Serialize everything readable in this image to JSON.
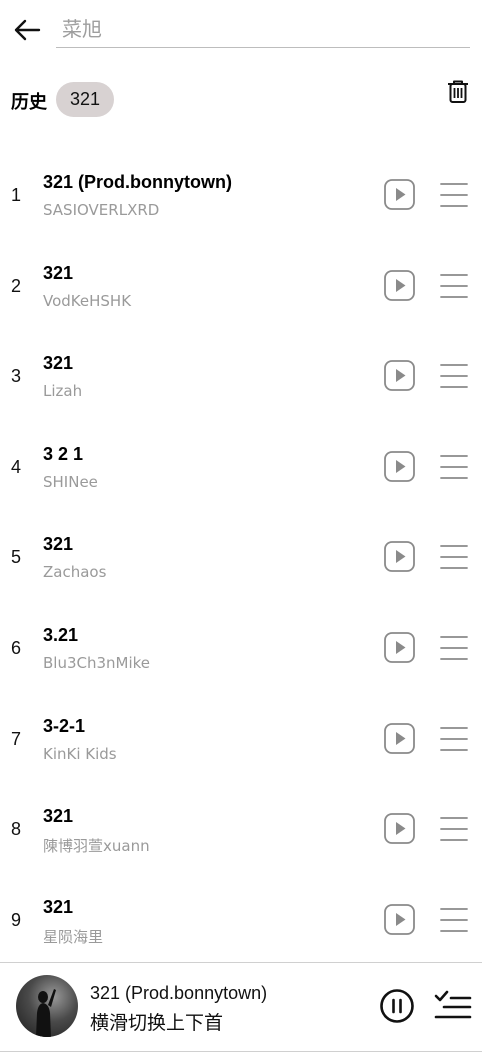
{
  "search": {
    "placeholder": "菜旭"
  },
  "history": {
    "label": "历史",
    "chips": [
      "321"
    ]
  },
  "songs": [
    {
      "index": "1",
      "title": "321 (Prod.bonnytown)",
      "artist": "SASIOVERLXRD"
    },
    {
      "index": "2",
      "title": "321",
      "artist": "VodKeHSHK"
    },
    {
      "index": "3",
      "title": "321",
      "artist": "Lizah"
    },
    {
      "index": "4",
      "title": "3 2 1",
      "artist": "SHINee"
    },
    {
      "index": "5",
      "title": "321",
      "artist": "Zachaos"
    },
    {
      "index": "6",
      "title": "3.21",
      "artist": "Blu3Ch3nMike"
    },
    {
      "index": "7",
      "title": "3-2-1",
      "artist": "KinKi Kids"
    },
    {
      "index": "8",
      "title": "321",
      "artist": "陳博羽萱xuann"
    },
    {
      "index": "9",
      "title": "321",
      "artist": "星陨海里"
    }
  ],
  "player": {
    "title": "321 (Prod.bonnytown)",
    "subtitle": "横滑切换上下首"
  },
  "icons": {
    "back": "arrow-left-icon",
    "trash": "trash-icon",
    "play": "play-circle-icon",
    "menu": "menu-icon",
    "pause": "pause-circle-icon",
    "queue": "playlist-check-icon"
  },
  "colors": {
    "chip_bg": "#d8d2d2",
    "artist_text": "#9a9a9a",
    "icon_gray": "#8a8a8a"
  }
}
